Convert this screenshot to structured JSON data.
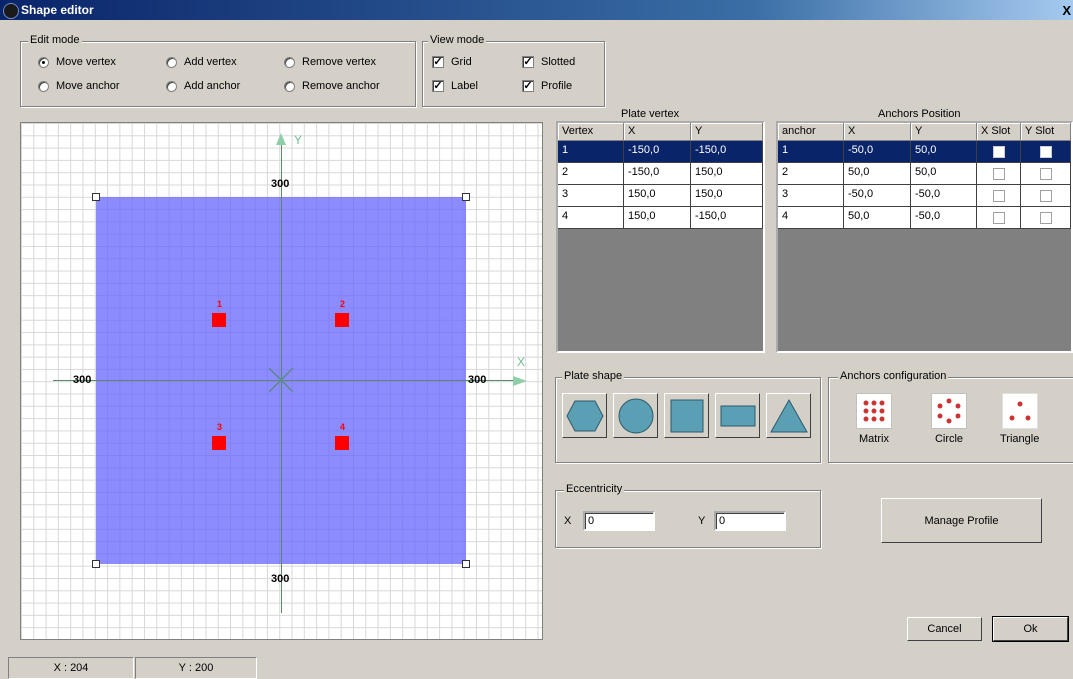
{
  "window": {
    "title": "Shape editor",
    "close_glyph": "X"
  },
  "edit_mode": {
    "label": "Edit mode",
    "options": [
      "Move vertex",
      "Add vertex",
      "Remove vertex",
      "Move anchor",
      "Add anchor",
      "Remove anchor"
    ],
    "selected": "Move vertex"
  },
  "view_mode": {
    "label": "View mode",
    "grid": "Grid",
    "slotted": "Slotted",
    "label_opt": "Label",
    "profile": "Profile",
    "check_mark": "✓"
  },
  "canvas": {
    "axis_x": "X",
    "axis_y": "Y",
    "dim_top": "300",
    "dim_bottom": "300",
    "dim_left": "300",
    "dim_right": "300",
    "anchor_labels": [
      "1",
      "2",
      "3",
      "4"
    ],
    "plate_color": "#6666ff",
    "anchor_color": "#ff0000"
  },
  "plate_vertex": {
    "title": "Plate vertex",
    "headers": [
      "Vertex",
      "X",
      "Y"
    ],
    "rows": [
      [
        "1",
        "-150,0",
        "-150,0"
      ],
      [
        "2",
        "-150,0",
        "150,0"
      ],
      [
        "3",
        "150,0",
        "150,0"
      ],
      [
        "4",
        "150,0",
        "-150,0"
      ]
    ]
  },
  "anchors_position": {
    "title": "Anchors Position",
    "headers": [
      "anchor",
      "X",
      "Y",
      "X Slot",
      "Y Slot"
    ],
    "rows": [
      [
        "1",
        "-50,0",
        "50,0"
      ],
      [
        "2",
        "50,0",
        "50,0"
      ],
      [
        "3",
        "-50,0",
        "-50,0"
      ],
      [
        "4",
        "50,0",
        "-50,0"
      ]
    ]
  },
  "plate_shape": {
    "label": "Plate shape",
    "shapes": [
      "hexagon-icon",
      "circle-icon",
      "square-icon",
      "rectangle-icon",
      "triangle-icon"
    ],
    "shape_color": "#5b9fb5"
  },
  "anchors_config": {
    "label": "Anchors configuration",
    "matrix": "Matrix",
    "circle": "Circle",
    "triangle": "Triangle"
  },
  "eccentricity": {
    "label": "Eccentricity",
    "x_label": "X",
    "x_value": "0",
    "y_label": "Y",
    "y_value": "0"
  },
  "buttons": {
    "manage_profile": "Manage Profile",
    "cancel": "Cancel",
    "ok": "Ok"
  },
  "status": {
    "x": "X : 204",
    "y": "Y : 200"
  }
}
